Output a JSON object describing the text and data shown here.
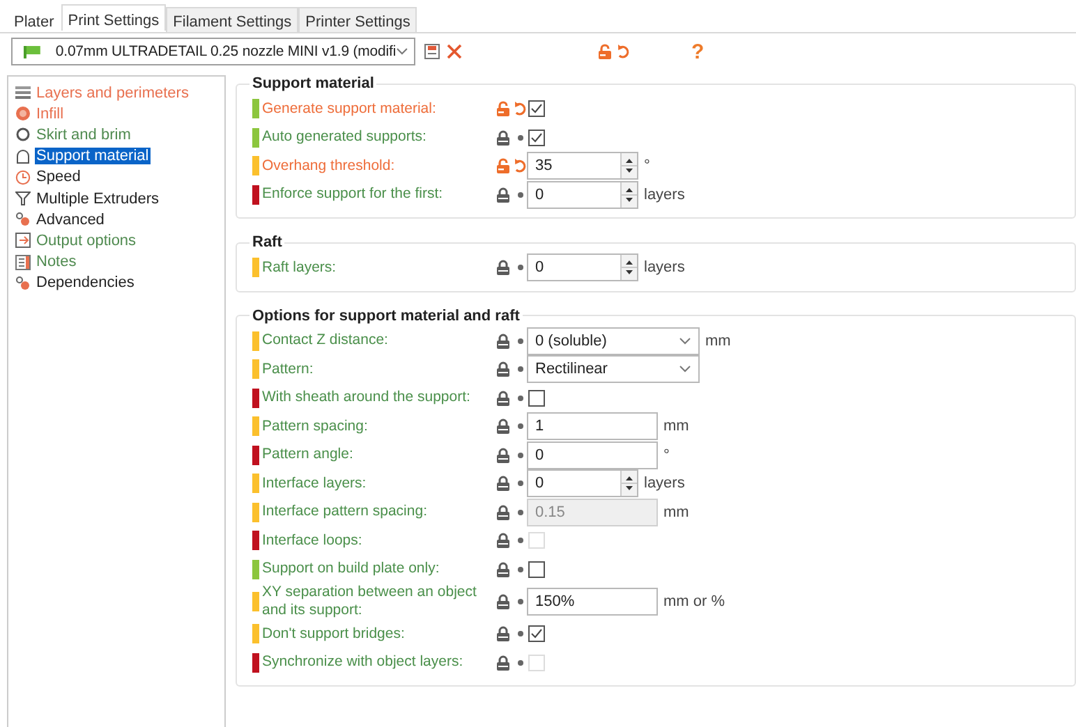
{
  "tabs": [
    {
      "label": "Plater",
      "selected": false
    },
    {
      "label": "Print Settings",
      "selected": true
    },
    {
      "label": "Filament Settings",
      "selected": false
    },
    {
      "label": "Printer Settings",
      "selected": false
    }
  ],
  "preset": {
    "value": "0.07mm ULTRADETAIL 0.25 nozzle MINI v1.9 (modifi",
    "modified": true,
    "help": "?"
  },
  "sidebar": {
    "items": [
      {
        "label": "Layers and perimeters",
        "color": "#e8704f",
        "selected": false
      },
      {
        "label": "Infill",
        "color": "#e8704f",
        "selected": false
      },
      {
        "label": "Skirt and brim",
        "color": "#4f8a4f",
        "selected": false
      },
      {
        "label": "Support material",
        "selected": true
      },
      {
        "label": "Speed",
        "color": "#222222",
        "selected": false
      },
      {
        "label": "Multiple Extruders",
        "color": "#222222",
        "selected": false
      },
      {
        "label": "Advanced",
        "color": "#222222",
        "selected": false
      },
      {
        "label": "Output options",
        "color": "#4f8a4f",
        "selected": false
      },
      {
        "label": "Notes",
        "color": "#4f8a4f",
        "selected": false
      },
      {
        "label": "Dependencies",
        "color": "#222222",
        "selected": false
      }
    ]
  },
  "sections": [
    {
      "title": "Support material",
      "options": [
        {
          "label": "Generate support material:",
          "color": "#8cc63e",
          "modified": true,
          "kind": "checkbox",
          "checked": true,
          "disabled": false
        },
        {
          "label": "Auto generated supports:",
          "color": "#8cc63e",
          "modified": false,
          "kind": "checkbox",
          "checked": true,
          "disabled": false
        },
        {
          "label": "Overhang threshold:",
          "color": "#fbc02d",
          "modified": true,
          "kind": "spin",
          "value": "35",
          "unit": "°",
          "disabled": false
        },
        {
          "label": "Enforce support for the first:",
          "color": "#c0111f",
          "modified": false,
          "kind": "spin",
          "value": "0",
          "unit": "layers",
          "disabled": false
        }
      ]
    },
    {
      "title": "Raft",
      "options": [
        {
          "label": "Raft layers:",
          "color": "#fbc02d",
          "modified": false,
          "kind": "spin",
          "value": "0",
          "unit": "layers",
          "disabled": false
        }
      ]
    },
    {
      "title": "Options for support material and raft",
      "options": [
        {
          "label": "Contact Z distance:",
          "color": "#fbc02d",
          "modified": false,
          "kind": "combo",
          "value": "0 (soluble)",
          "unit": "mm",
          "disabled": false
        },
        {
          "label": "Pattern:",
          "color": "#fbc02d",
          "modified": false,
          "kind": "combo",
          "value": "Rectilinear",
          "disabled": false
        },
        {
          "label": "With sheath around the support:",
          "color": "#c0111f",
          "modified": false,
          "kind": "checkbox",
          "checked": false,
          "disabled": false
        },
        {
          "label": "Pattern spacing:",
          "color": "#fbc02d",
          "modified": false,
          "kind": "text",
          "value": "1",
          "unit": "mm",
          "disabled": false
        },
        {
          "label": "Pattern angle:",
          "color": "#c0111f",
          "modified": false,
          "kind": "text",
          "value": "0",
          "unit": "°",
          "disabled": false
        },
        {
          "label": "Interface layers:",
          "color": "#fbc02d",
          "modified": false,
          "kind": "spin",
          "value": "0",
          "unit": "layers",
          "disabled": false
        },
        {
          "label": "Interface pattern spacing:",
          "color": "#fbc02d",
          "modified": false,
          "kind": "text",
          "value": "0.15",
          "unit": "mm",
          "disabled": true
        },
        {
          "label": "Interface loops:",
          "color": "#c0111f",
          "modified": false,
          "kind": "checkbox",
          "checked": false,
          "disabled": true
        },
        {
          "label": "Support on build plate only:",
          "color": "#8cc63e",
          "modified": false,
          "kind": "checkbox",
          "checked": false,
          "disabled": false
        },
        {
          "label": "XY separation between an object and its support:",
          "color": "#fbc02d",
          "modified": false,
          "kind": "text",
          "value": "150%",
          "unit": "mm or %",
          "disabled": false
        },
        {
          "label": "Don't support bridges:",
          "color": "#fbc02d",
          "modified": false,
          "kind": "checkbox",
          "checked": true,
          "disabled": false
        },
        {
          "label": "Synchronize with object layers:",
          "color": "#c0111f",
          "modified": false,
          "kind": "checkbox",
          "checked": false,
          "disabled": true
        }
      ]
    }
  ]
}
